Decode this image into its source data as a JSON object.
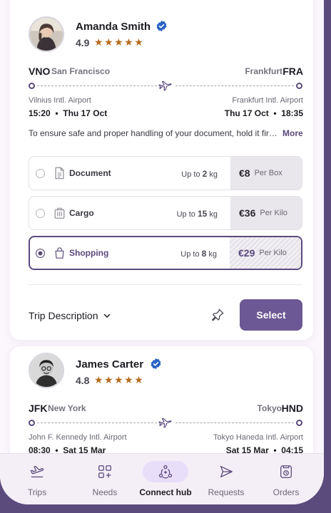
{
  "offers": [
    {
      "traveler": {
        "name": "Amanda Smith",
        "rating": "4.9",
        "stars": "★★★★★"
      },
      "origin": {
        "code": "VNO",
        "city": "San Francisco",
        "airport": "Vilnius Intl. Airport",
        "time": "15:20",
        "date": "Thu 17 Oct"
      },
      "destination": {
        "code": "FRA",
        "city": "Frankfurt",
        "airport": "Frankfurt Intl. Airport",
        "time": "18:35",
        "date": "Thu 17 Oct"
      },
      "note": "To ensure safe and proper handling of your document, hold it fir…",
      "more_label": "More",
      "options": [
        {
          "label": "Document",
          "limit_prefix": "Up to",
          "limit_value": "2",
          "limit_unit": "kg",
          "price": "€8",
          "price_unit": "Per Box",
          "selected": false,
          "icon": "document-icon"
        },
        {
          "label": "Cargo",
          "limit_prefix": "Up to",
          "limit_value": "15",
          "limit_unit": "kg",
          "price": "€36",
          "price_unit": "Per Kilo",
          "selected": false,
          "icon": "cargo-icon"
        },
        {
          "label": "Shopping",
          "limit_prefix": "Up to",
          "limit_value": "8",
          "limit_unit": "kg",
          "price": "€29",
          "price_unit": "Per Kilo",
          "selected": true,
          "icon": "shopping-bag-icon"
        }
      ],
      "trip_description_label": "Trip Description",
      "select_label": "Select"
    },
    {
      "traveler": {
        "name": "James Carter",
        "rating": "4.8",
        "stars": "★★★★★"
      },
      "origin": {
        "code": "JFK",
        "city": "New York",
        "airport": "John F. Kennedy  Intl. Airport",
        "time": "08:30",
        "date": "Sat 15 Mar"
      },
      "destination": {
        "code": "HND",
        "city": "Tokyo",
        "airport": "Tokyo Haneda Intl. Airport",
        "time": "04:15",
        "date": "Sat 15 Mar"
      }
    }
  ],
  "nav": [
    {
      "label": "Trips",
      "icon": "plane-takeoff-icon",
      "active": false
    },
    {
      "label": "Needs",
      "icon": "grid-plus-icon",
      "active": false
    },
    {
      "label": "Connect hub",
      "icon": "hub-icon",
      "active": true
    },
    {
      "label": "Requests",
      "icon": "send-icon",
      "active": false
    },
    {
      "label": "Orders",
      "icon": "orders-icon",
      "active": false
    }
  ],
  "colors": {
    "accent": "#6c5894",
    "frame": "#5b4a7c",
    "star": "#b76b1c",
    "verified": "#2a63c6"
  }
}
